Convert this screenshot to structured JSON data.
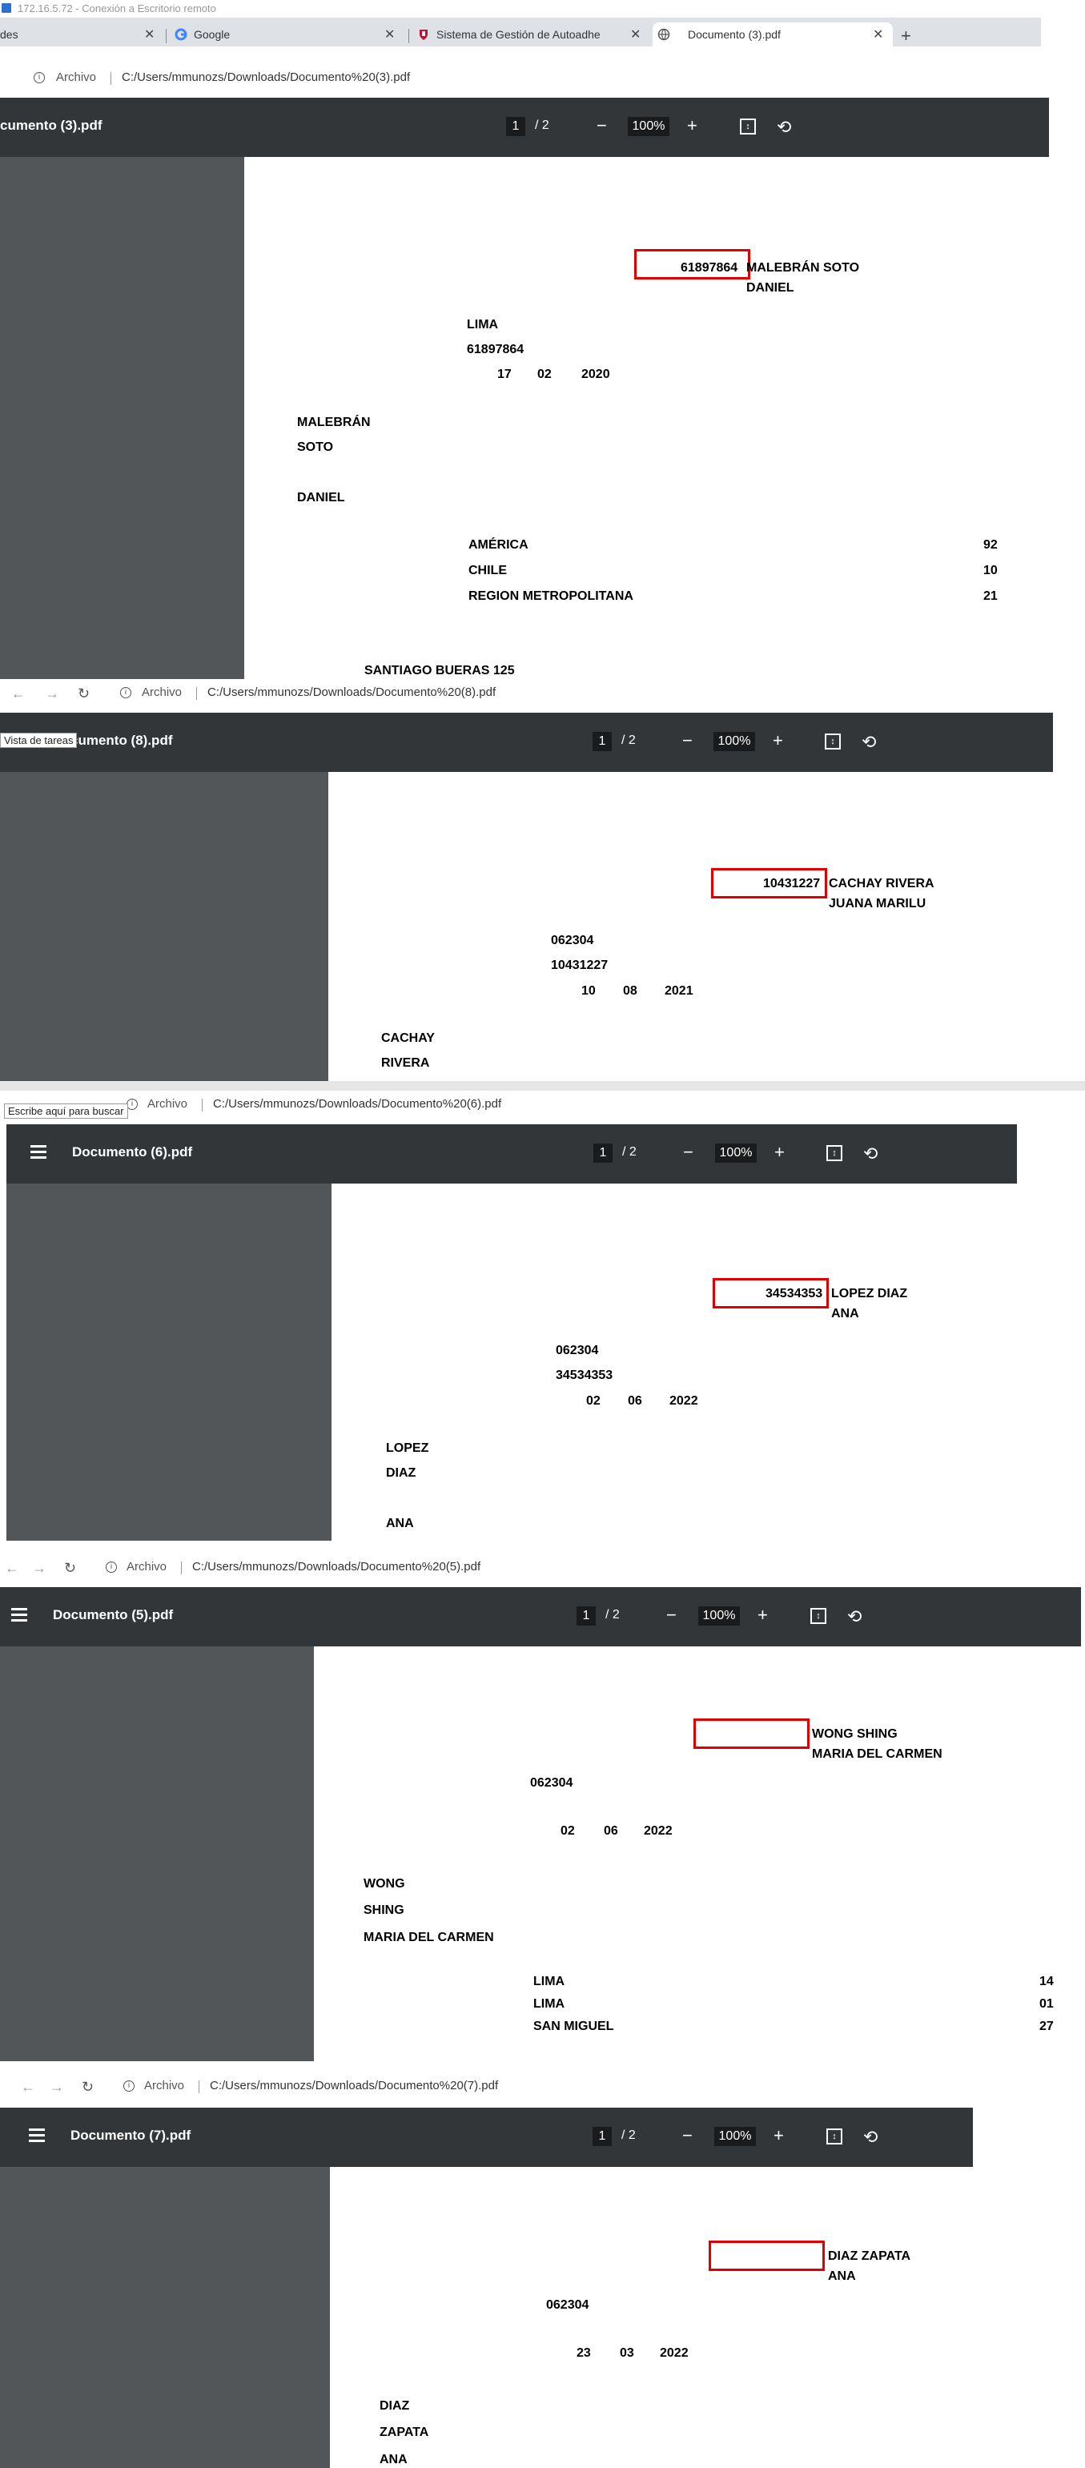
{
  "rdp_title": "172.16.5.72 - Conexión a Escritorio remoto",
  "tabs": [
    {
      "label": "des"
    },
    {
      "label": "Google"
    },
    {
      "label": "Sistema de Gestión de Autoadhe"
    },
    {
      "label": "Documento (3).pdf"
    }
  ],
  "address": {
    "scheme_label": "Archivo"
  },
  "tooltips": {
    "taskview": "Vista de tareas",
    "search": "Escribe aquí para buscar"
  },
  "pdf_toolbar": {
    "page_current": "1",
    "page_sep": "/",
    "page_total": "2",
    "zoom": "100%"
  },
  "documents": [
    {
      "title": "cumento (3).pdf",
      "url": "C:/Users/mmunozs/Downloads/Documento%20(3).pdf",
      "lines": [
        "61897864",
        "MALEBRÁN SOTO",
        "DANIEL",
        "LIMA",
        "61897864",
        "17",
        "02",
        "2020",
        "MALEBRÁN",
        "SOTO",
        "DANIEL",
        "AMÉRICA",
        "92",
        "CHILE",
        "10",
        "REGION METROPOLITANA",
        "21",
        "SANTIAGO BUERAS 125"
      ]
    },
    {
      "title": "cumento (8).pdf",
      "url": "C:/Users/mmunozs/Downloads/Documento%20(8).pdf",
      "lines": [
        "10431227",
        "CACHAY RIVERA",
        "JUANA MARILU",
        "062304",
        "10431227",
        "10",
        "08",
        "2021",
        "CACHAY",
        "RIVERA"
      ]
    },
    {
      "title": "Documento (6).pdf",
      "url": "C:/Users/mmunozs/Downloads/Documento%20(6).pdf",
      "lines": [
        "34534353",
        "LOPEZ DIAZ",
        "ANA",
        "062304",
        "34534353",
        "02",
        "06",
        "2022",
        "LOPEZ",
        "DIAZ",
        "ANA"
      ]
    },
    {
      "title": "Documento (5).pdf",
      "url": "C:/Users/mmunozs/Downloads/Documento%20(5).pdf",
      "lines": [
        "WONG SHING",
        "MARIA DEL CARMEN",
        "062304",
        "02",
        "06",
        "2022",
        "WONG",
        "SHING",
        "MARIA DEL CARMEN",
        "LIMA",
        "14",
        "LIMA",
        "01",
        "SAN MIGUEL",
        "27"
      ]
    },
    {
      "title": "Documento (7).pdf",
      "url": "C:/Users/mmunozs/Downloads/Documento%20(7).pdf",
      "lines": [
        "DIAZ ZAPATA",
        "ANA",
        "062304",
        "23",
        "03",
        "2022",
        "DIAZ",
        "ZAPATA",
        "ANA"
      ]
    }
  ]
}
